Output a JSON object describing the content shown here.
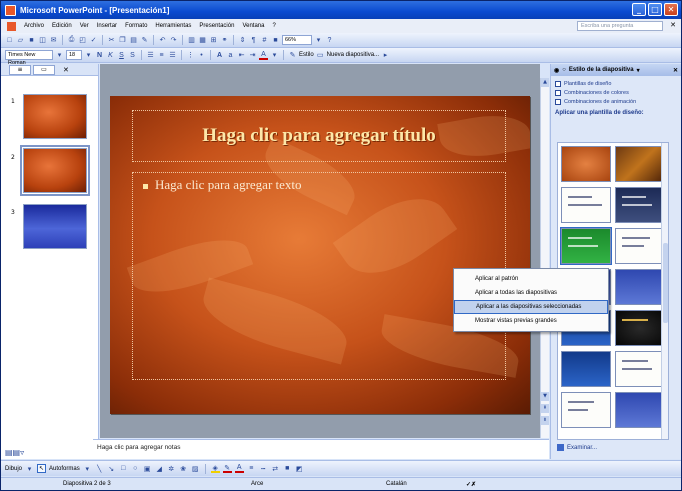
{
  "window": {
    "title": "Microsoft PowerPoint - [Presentación1]"
  },
  "menubar": {
    "items": [
      "Archivo",
      "Edición",
      "Ver",
      "Insertar",
      "Formato",
      "Herramientas",
      "Presentación",
      "Ventana",
      "?"
    ],
    "help_placeholder": "Escriba una pregunta"
  },
  "toolbar": {
    "zoom": "66%",
    "font_name": "Times New Roman",
    "font_size": "18",
    "design_label": "Estilo",
    "new_slide_label": "Nueva diapositiva..."
  },
  "outline": {
    "tab_outline": "≡",
    "tab_slides": "▭",
    "slide_numbers": [
      "1",
      "2",
      "3"
    ]
  },
  "slide": {
    "title_placeholder": "Haga clic para agregar título",
    "body_placeholder": "Haga clic para agregar texto"
  },
  "notes": {
    "placeholder": "Haga clic para agregar notas"
  },
  "taskpane": {
    "title": "Estilo de la diapositiva",
    "links": [
      "Plantillas de diseño",
      "Combinaciones de colores",
      "Combinaciones de animación"
    ],
    "section": "Aplicar una plantilla de diseño:",
    "browse": "Examinar..."
  },
  "context_menu": {
    "items": [
      "Aplicar al patrón",
      "Aplicar a todas las diapositivas",
      "Aplicar a las diapositivas seleccionadas",
      "Mostrar vistas previas grandes"
    ]
  },
  "drawbar": {
    "draw_label": "Dibujo",
    "autoshapes_label": "Autoformas"
  },
  "statusbar": {
    "slide_count": "Diapositiva 2 de 3",
    "design_name": "Arce",
    "language": "Catalán"
  },
  "colors": {
    "titlebar": "#0a4ad0",
    "slide_background": "#c6521a",
    "slide_title": "#fde7a8",
    "highlight": "#c1d2ee"
  }
}
